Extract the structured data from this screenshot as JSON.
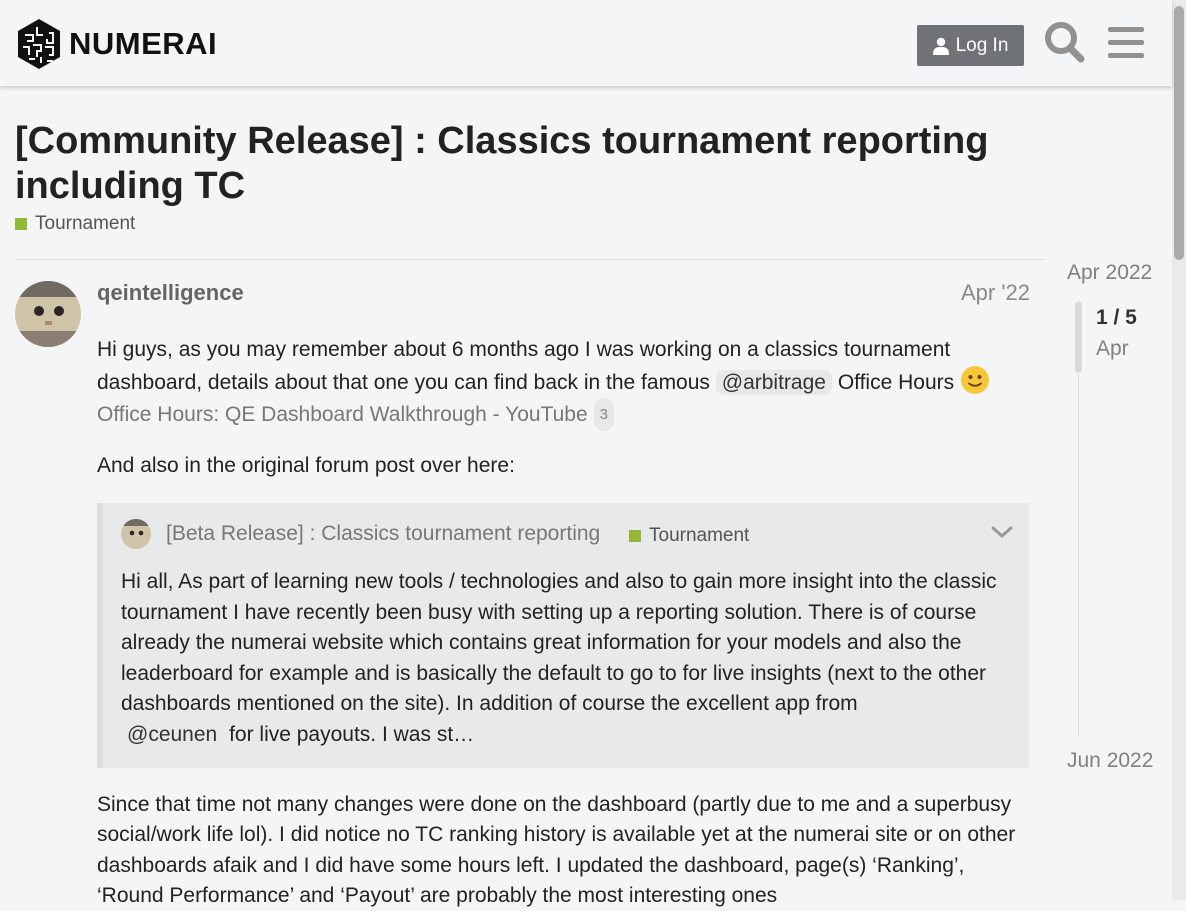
{
  "header": {
    "brand": "NUMERAI",
    "login_label": "Log In"
  },
  "topic": {
    "title": "[Community Release] : Classics tournament reporting including TC",
    "category": "Tournament",
    "category_color": "#92b739"
  },
  "post": {
    "username": "qeintelligence",
    "date": "Apr '22",
    "p1_text": "Hi guys, as you may remember about 6 months ago I was working on a classics tournament dashboard, details about that one you can find back in the famous",
    "mention1": "@arbitrage",
    "p1_after": "Office Hours",
    "emoji": "slightly-smiling-face",
    "onebox_link": "Office Hours: QE Dashboard Walkthrough - YouTube",
    "onebox_count": "3",
    "p2": "And also in the original forum post over here:",
    "quote": {
      "title": "[Beta Release] : Classics tournament reporting",
      "category": "Tournament",
      "text": "Hi all, As part of learning new tools / technologies and also to gain more insight into the classic tournament I have recently been busy with setting up a reporting solution. There is of course already the numerai website which contains great information for your models and also the leaderboard for example and is basically the default to go to for live insights (next to the other dashboards mentioned on the site). In addition of course the excellent app from",
      "mention": "@ceunen",
      "text_after": "for live payouts. I was st…"
    },
    "p3": "Since that time not many changes were done on the dashboard (partly due to me and a superbusy social/work life lol). I did notice no TC ranking history is available yet at the numerai site or on other dashboards afaik and I did have some hours left. I updated the dashboard, page(s) ‘Ranking’, ‘Round Performance’ and ‘Payout’ are probably the most interesting ones"
  },
  "timeline": {
    "top_date": "Apr 2022",
    "position": "1 / 5",
    "handle_date": "Apr",
    "bottom_date": "Jun 2022"
  }
}
